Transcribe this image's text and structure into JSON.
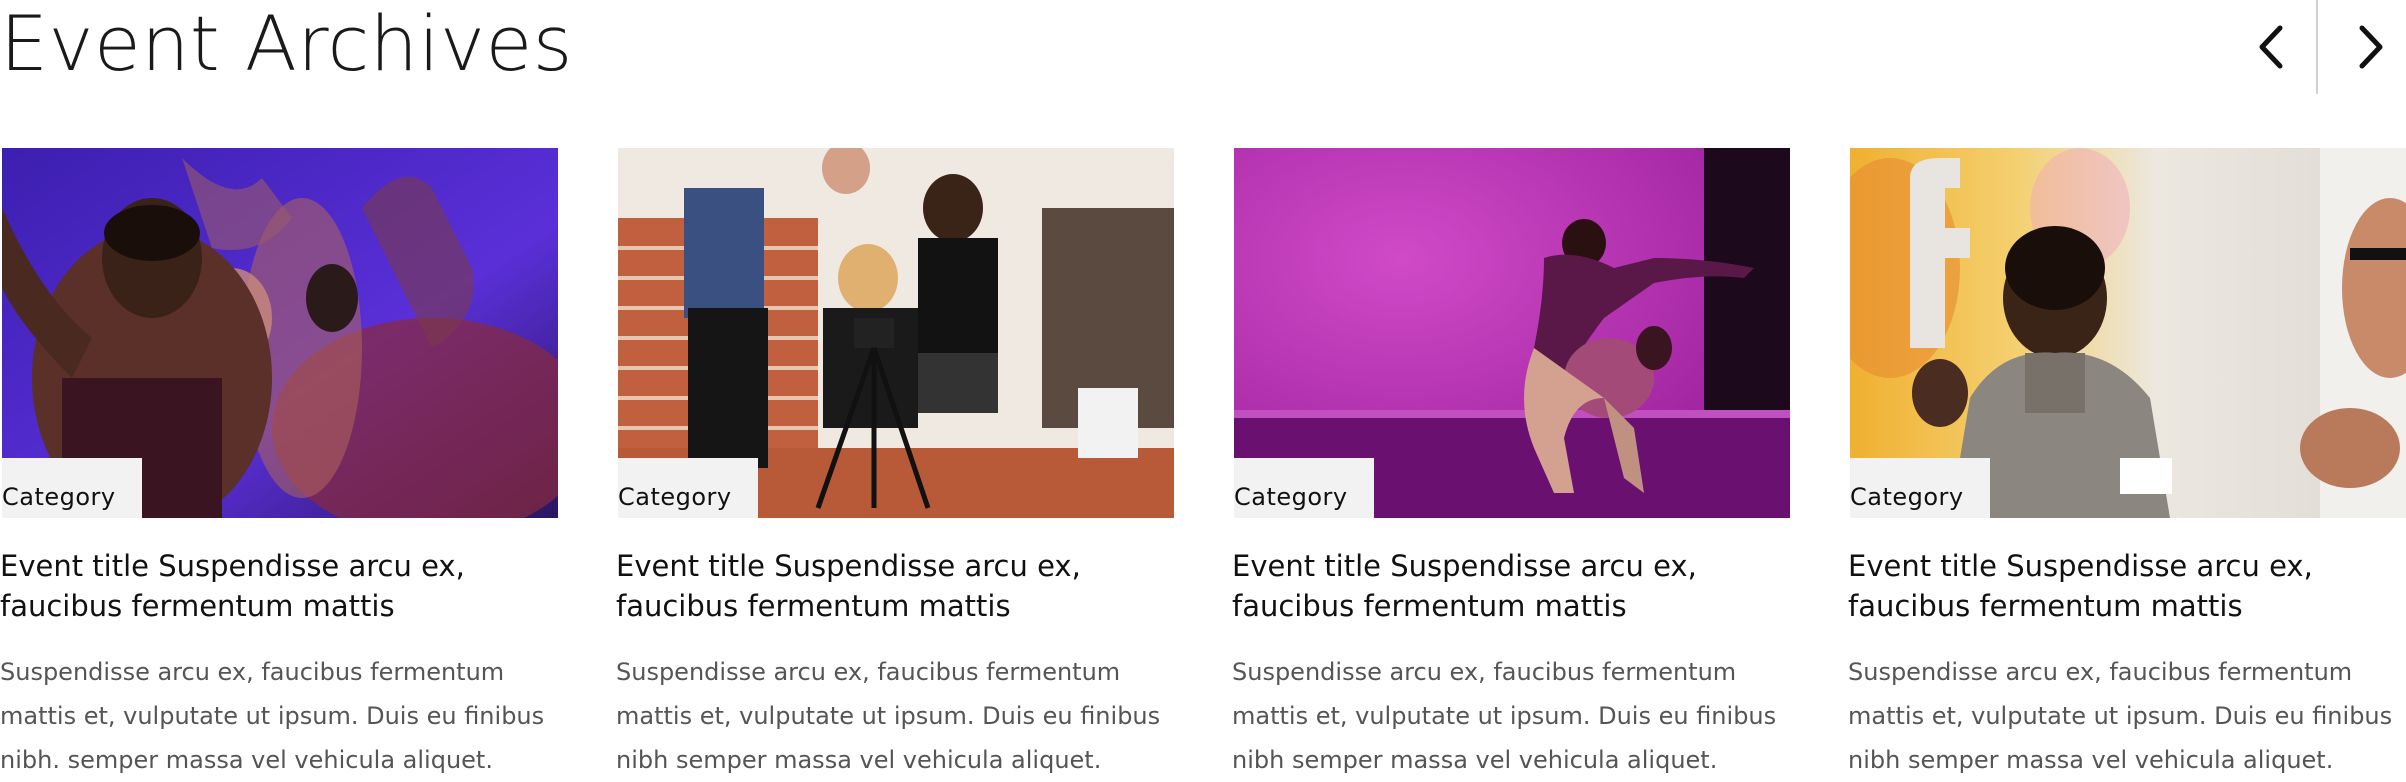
{
  "header": {
    "title": "Event Archives",
    "prev_icon": "chevron-left-icon",
    "next_icon": "chevron-right-icon"
  },
  "events": [
    {
      "image": "dance-performance-photo",
      "category": "Category",
      "title": "Event title Suspendisse arcu ex, faucibus fermentum mattis",
      "description": "Suspendisse arcu ex, faucibus fermentum mattis et, vulputate ut ipsum. Duis eu finibus nibh. semper massa vel vehicula aliquet."
    },
    {
      "image": "film-crew-photo",
      "category": "Category",
      "title": "Event title Suspendisse arcu ex, faucibus fermentum mattis",
      "description": "Suspendisse arcu ex, faucibus fermentum mattis et, vulputate ut ipsum. Duis eu finibus nibh semper massa vel vehicula aliquet."
    },
    {
      "image": "duet-dance-photo",
      "category": "Category",
      "title": "Event title Suspendisse arcu ex, faucibus fermentum mattis",
      "description": "Suspendisse arcu ex, faucibus fermentum mattis et, vulputate ut ipsum. Duis eu finibus nibh semper massa vel vehicula aliquet."
    },
    {
      "image": "conversation-photo",
      "category": "Category",
      "title": "Event title Suspendisse arcu ex, faucibus fermentum mattis",
      "description": "Suspendisse arcu ex, faucibus fermentum mattis et, vulputate ut ipsum. Duis eu finibus nibh semper massa vel vehicula aliquet."
    }
  ]
}
